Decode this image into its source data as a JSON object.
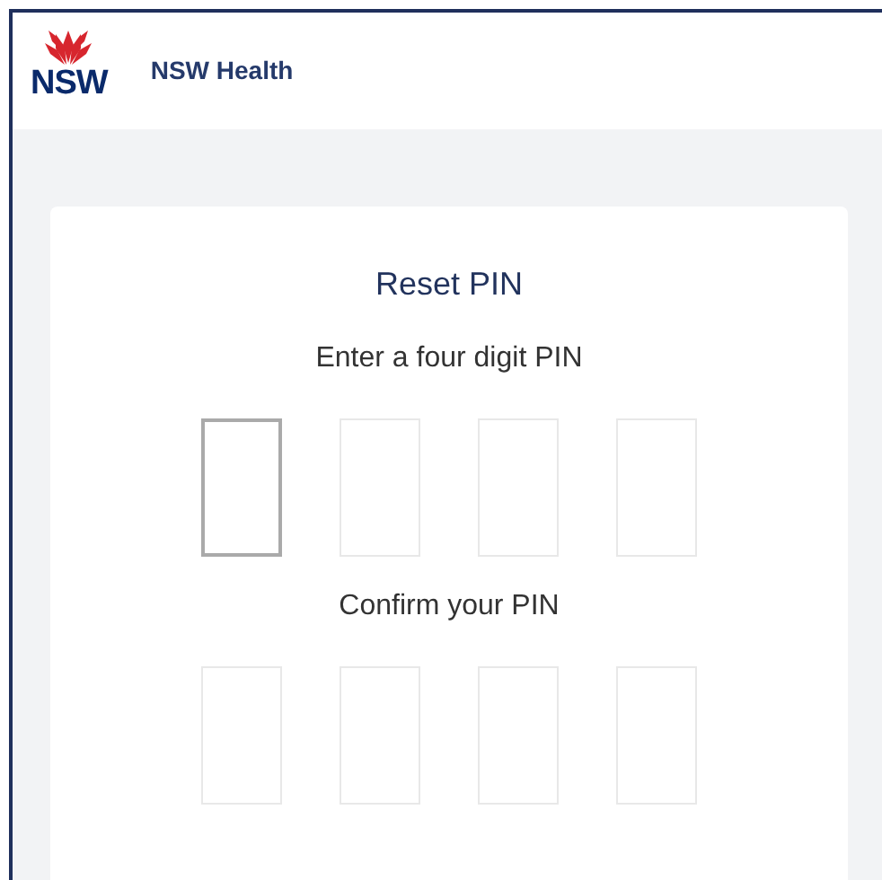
{
  "header": {
    "logo_text": "NSW",
    "title": "NSW Health"
  },
  "card": {
    "title": "Reset PIN",
    "sections": [
      {
        "label": "Enter a four digit PIN",
        "digits": [
          {
            "focused": true
          },
          {
            "focused": false
          },
          {
            "focused": false
          },
          {
            "focused": false
          }
        ]
      },
      {
        "label": "Confirm your PIN",
        "digits": [
          {
            "focused": false
          },
          {
            "focused": false
          },
          {
            "focused": false
          },
          {
            "focused": false
          }
        ]
      }
    ]
  }
}
